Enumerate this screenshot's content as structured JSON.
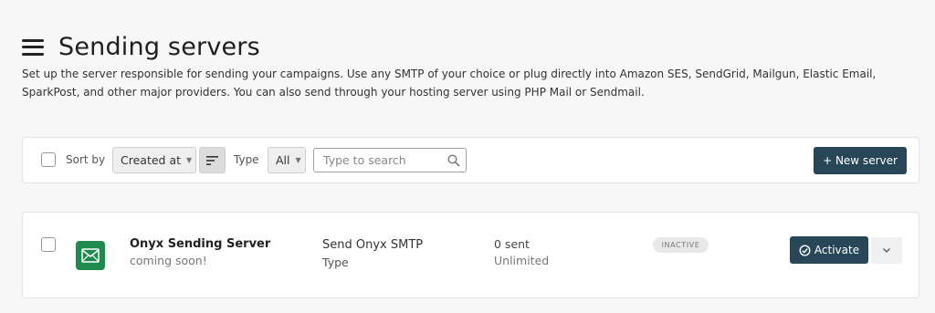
{
  "header": {
    "title": "Sending servers",
    "description": "Set up the server responsible for sending your campaigns. Use any SMTP of your choice or plug directly into Amazon SES, SendGrid, Mailgun, Elastic Email, SparkPost, and other major providers. You can also send through your hosting server using PHP Mail or Sendmail."
  },
  "toolbar": {
    "sort_label": "Sort by",
    "sort_value": "Created at",
    "type_label": "Type",
    "type_value": "All",
    "search_placeholder": "Type to search",
    "new_button": "+ New server"
  },
  "servers": [
    {
      "name": "Onyx Sending Server",
      "subtitle": "coming soon!",
      "type_value": "Send Onyx SMTP",
      "type_label": "Type",
      "sent": "0 sent",
      "limit": "Unlimited",
      "status": "INACTIVE",
      "action": "Activate"
    }
  ],
  "colors": {
    "primary": "#274758",
    "logo": "#1f8a4c",
    "background": "#f7f7f7"
  },
  "icons": {
    "menu": "hamburger-icon",
    "sort": "sort-lines-icon",
    "search": "magnifier-icon",
    "logo": "envelope-icon",
    "activate": "check-circle-icon",
    "dropdown": "chevron-down-icon"
  }
}
